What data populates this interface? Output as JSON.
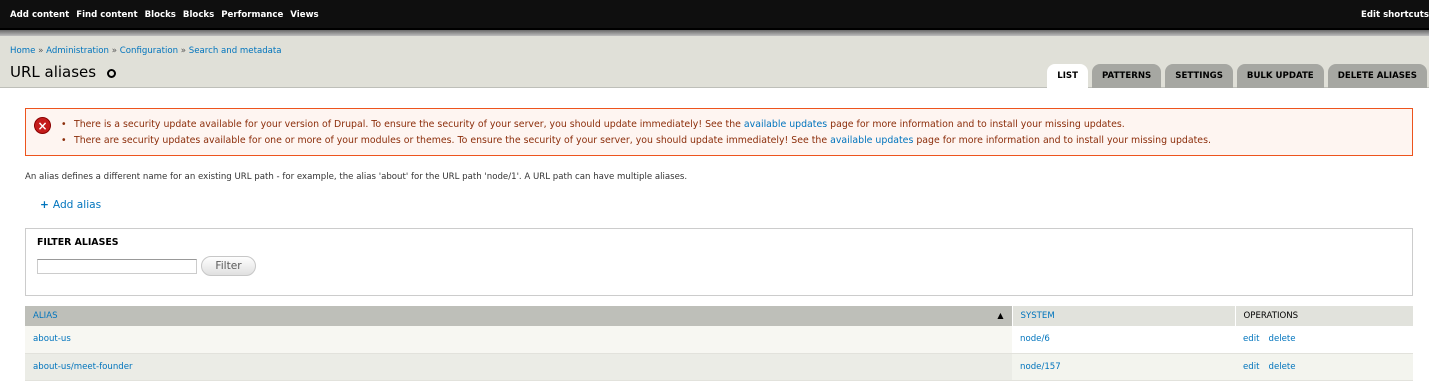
{
  "toolbar": {
    "menu": [
      "Add content",
      "Find content",
      "Blocks",
      "Blocks",
      "Performance",
      "Views"
    ],
    "shortcuts_label": "Edit shortcuts"
  },
  "breadcrumb": {
    "home": "Home",
    "separator": "»",
    "administration": "Administration",
    "configuration": "Configuration",
    "search_metadata": "Search and metadata"
  },
  "page_title": "URL aliases",
  "tabs": [
    "LIST",
    "PATTERNS",
    "SETTINGS",
    "BULK UPDATE",
    "DELETE ALIASES"
  ],
  "messages": {
    "error_icon": "x-icon",
    "items": [
      {
        "before": "There is a security update available for your version of Drupal. To ensure the security of your server, you should update immediately! See the ",
        "link": "available updates",
        "after": " page for more information and to install your missing updates."
      },
      {
        "before": "There are security updates available for one or more of your modules or themes. To ensure the security of your server, you should update immediately! See the ",
        "link": "available updates",
        "after": " page for more information and to install your missing updates."
      }
    ]
  },
  "help_text": "An alias defines a different name for an existing URL path - for example, the alias 'about' for the URL path 'node/1'. A URL path can have multiple aliases.",
  "add_alias": {
    "plus": "+",
    "label": "Add alias"
  },
  "filter": {
    "legend": "FILTER ALIASES",
    "input_value": "",
    "button_label": "Filter"
  },
  "table": {
    "headers": {
      "alias": "ALIAS",
      "sort_arrow": "▲",
      "system": "SYSTEM",
      "operations": "OPERATIONS"
    },
    "rows": [
      {
        "alias": "about-us",
        "system": "node/6",
        "edit": "edit",
        "delete": "delete"
      },
      {
        "alias": "about-us/meet-founder",
        "system": "node/157",
        "edit": "edit",
        "delete": "delete"
      }
    ]
  },
  "colors": {
    "toolbar_bg": "#0f0f0f",
    "header_bg": "#e0e0d8",
    "link": "#0074bd",
    "error_border": "#ed541d",
    "error_bg": "#fef5f1",
    "error_text": "#8c2e0b"
  }
}
